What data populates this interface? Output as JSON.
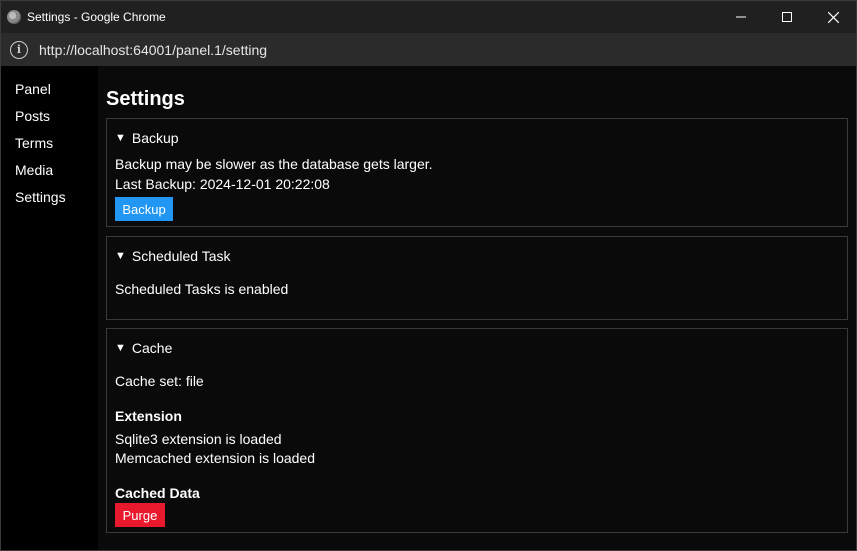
{
  "window": {
    "title": "Settings - Google Chrome",
    "controls": {
      "minimize": "—",
      "maximize": "☐",
      "close": "✕"
    }
  },
  "address": {
    "url": "http://localhost:64001/panel.1/setting"
  },
  "sidebar": {
    "items": [
      {
        "label": "Panel"
      },
      {
        "label": "Posts"
      },
      {
        "label": "Terms"
      },
      {
        "label": "Media"
      },
      {
        "label": "Settings"
      }
    ]
  },
  "page": {
    "title": "Settings"
  },
  "sections": {
    "backup": {
      "summary": "Backup",
      "note": "Backup may be slower as the database gets larger.",
      "last_backup": "Last Backup: 2024-12-01 20:22:08",
      "button": "Backup"
    },
    "scheduled": {
      "summary": "Scheduled Task",
      "status": "Scheduled Tasks is enabled"
    },
    "cache": {
      "summary": "Cache",
      "cache_set": "Cache set: file",
      "extension_heading": "Extension",
      "ext_sqlite": "Sqlite3 extension is loaded",
      "ext_memcached": "Memcached extension is loaded",
      "cached_data_heading": "Cached Data",
      "purge_button": "Purge"
    }
  },
  "colors": {
    "backup_button": "#2196f3",
    "purge_button": "#e8192c"
  },
  "icons": {
    "disclosure": "▼"
  }
}
